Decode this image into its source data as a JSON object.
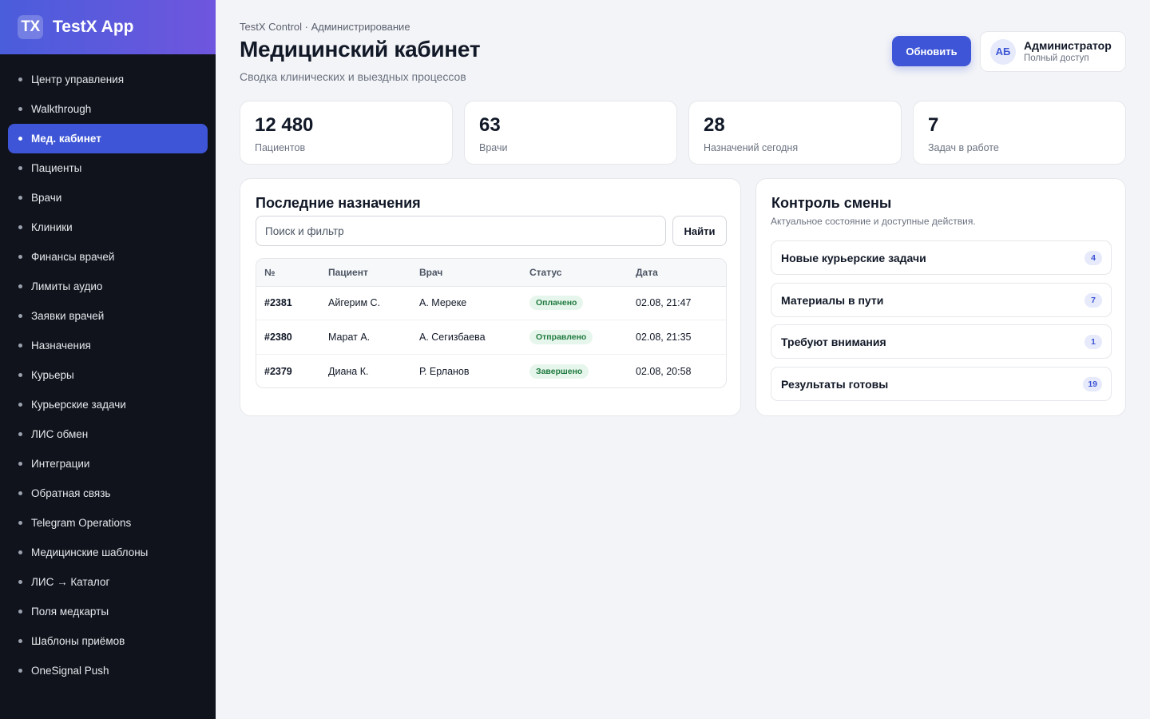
{
  "app": {
    "logo": "TX",
    "name": "TestX App"
  },
  "sidebar": {
    "items": [
      {
        "label": "Центр управления",
        "active": false
      },
      {
        "label": "Walkthrough",
        "active": false
      },
      {
        "label": "Мед. кабинет",
        "active": true
      },
      {
        "label": "Пациенты",
        "active": false
      },
      {
        "label": "Врачи",
        "active": false
      },
      {
        "label": "Клиники",
        "active": false
      },
      {
        "label": "Финансы врачей",
        "active": false
      },
      {
        "label": "Лимиты аудио",
        "active": false
      },
      {
        "label": "Заявки врачей",
        "active": false
      },
      {
        "label": "Назначения",
        "active": false
      },
      {
        "label": "Курьеры",
        "active": false
      },
      {
        "label": "Курьерские задачи",
        "active": false
      },
      {
        "label": "ЛИС обмен",
        "active": false
      },
      {
        "label": "Интеграции",
        "active": false
      },
      {
        "label": "Обратная связь",
        "active": false
      },
      {
        "label": "Telegram Operations",
        "active": false
      },
      {
        "label": "Медицинские шаблоны",
        "active": false
      },
      {
        "label": "ЛИС → Каталог",
        "active": false
      },
      {
        "label": "Поля медкарты",
        "active": false
      },
      {
        "label": "Шаблоны приёмов",
        "active": false
      },
      {
        "label": "OneSignal Push",
        "active": false
      }
    ]
  },
  "header": {
    "breadcrumb": "TestX Control · Администрирование",
    "title": "Медицинский кабинет",
    "subtitle": "Сводка клинических и выездных процессов",
    "refresh_label": "Обновить"
  },
  "user": {
    "initials": "АБ",
    "name": "Администратор",
    "role": "Полный доступ"
  },
  "stats": [
    {
      "value": "12 480",
      "label": "Пациентов"
    },
    {
      "value": "63",
      "label": "Врачи"
    },
    {
      "value": "28",
      "label": "Назначений сегодня"
    },
    {
      "value": "7",
      "label": "Задач в работе"
    }
  ],
  "appointments": {
    "title": "Последние назначения",
    "search_placeholder": "Поиск и фильтр",
    "find_label": "Найти",
    "columns": [
      "№",
      "Пациент",
      "Врач",
      "Статус",
      "Дата"
    ],
    "rows": [
      {
        "num": "#2381",
        "patient": "Айгерим С.",
        "doctor": "А. Мереке",
        "status": "Оплачено",
        "date": "02.08, 21:47"
      },
      {
        "num": "#2380",
        "patient": "Марат А.",
        "doctor": "А. Сегизбаева",
        "status": "Отправлено",
        "date": "02.08, 21:35"
      },
      {
        "num": "#2379",
        "patient": "Диана К.",
        "doctor": "Р. Ерланов",
        "status": "Завершено",
        "date": "02.08, 20:58"
      }
    ]
  },
  "shift": {
    "title": "Контроль смены",
    "subtitle": "Актуальное состояние и доступные действия.",
    "items": [
      {
        "label": "Новые курьерские задачи",
        "count": "4"
      },
      {
        "label": "Материалы в пути",
        "count": "7"
      },
      {
        "label": "Требуют внимания",
        "count": "1"
      },
      {
        "label": "Результаты готовы",
        "count": "19"
      }
    ]
  },
  "colors": {
    "accent": "#3d55d6",
    "sidebar_bg": "#10131c",
    "status_green": "#1f7a3f"
  }
}
